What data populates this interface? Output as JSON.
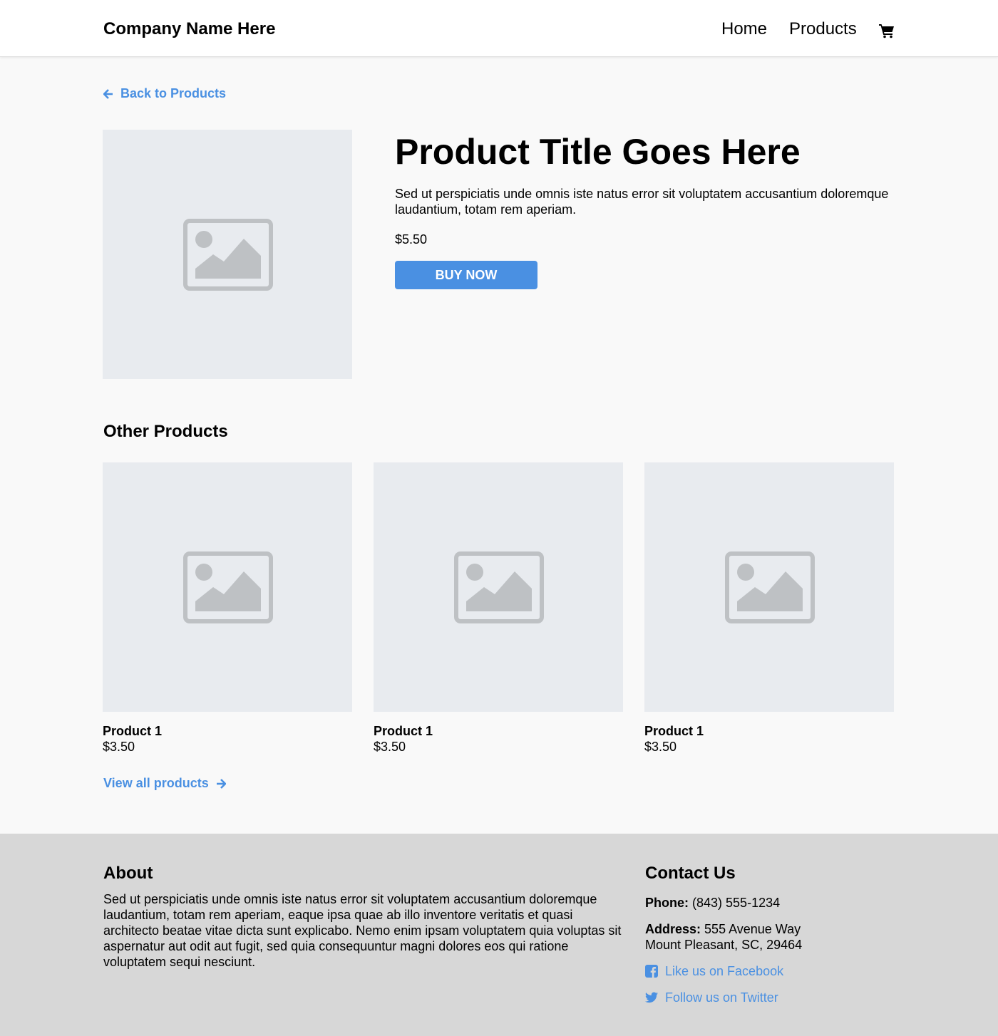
{
  "header": {
    "brand": "Company Name Here",
    "nav": {
      "home": "Home",
      "products": "Products"
    },
    "cart_icon": "shopping-cart-icon"
  },
  "product": {
    "back_label": "Back to Products",
    "back_icon": "arrow-left-icon",
    "image_icon": "image-placeholder-icon",
    "title": "Product Title Goes Here",
    "description": "Sed ut perspiciatis unde omnis iste natus error sit voluptatem accusantium doloremque laudantium, totam rem aperiam.",
    "price": "$5.50",
    "buy_label": "BUY NOW"
  },
  "other_products": {
    "title": "Other Products",
    "items": [
      {
        "name": "Product 1",
        "price": "$3.50"
      },
      {
        "name": "Product 1",
        "price": "$3.50"
      },
      {
        "name": "Product 1",
        "price": "$3.50"
      }
    ],
    "view_all_label": "View all products",
    "view_all_icon": "arrow-right-icon"
  },
  "footer": {
    "about": {
      "title": "About",
      "text": "Sed ut perspiciatis unde omnis iste natus error sit voluptatem accusantium doloremque laudantium, totam rem aperiam, eaque ipsa quae ab illo inventore veritatis et quasi architecto beatae vitae dicta sunt explicabo. Nemo enim ipsam voluptatem quia voluptas sit aspernatur aut odit aut fugit, sed quia consequuntur magni dolores eos qui ratione voluptatem sequi nesciunt."
    },
    "contact": {
      "title": "Contact Us",
      "phone_label": "Phone:",
      "phone": "(843) 555-1234",
      "address_label": "Address:",
      "address_line1": "555 Avenue Way",
      "address_line2": "Mount Pleasant, SC, 29464",
      "facebook_label": "Like us on Facebook",
      "facebook_icon": "facebook-icon",
      "twitter_label": "Follow us on Twitter",
      "twitter_icon": "twitter-icon"
    }
  },
  "colors": {
    "accent": "#4a90e2",
    "page_bg": "#f9f9f9",
    "header_bg": "#ffffff",
    "footer_bg": "#d7d7d7",
    "placeholder_bg": "#e8ebef",
    "placeholder_icon": "#bec1c4"
  }
}
